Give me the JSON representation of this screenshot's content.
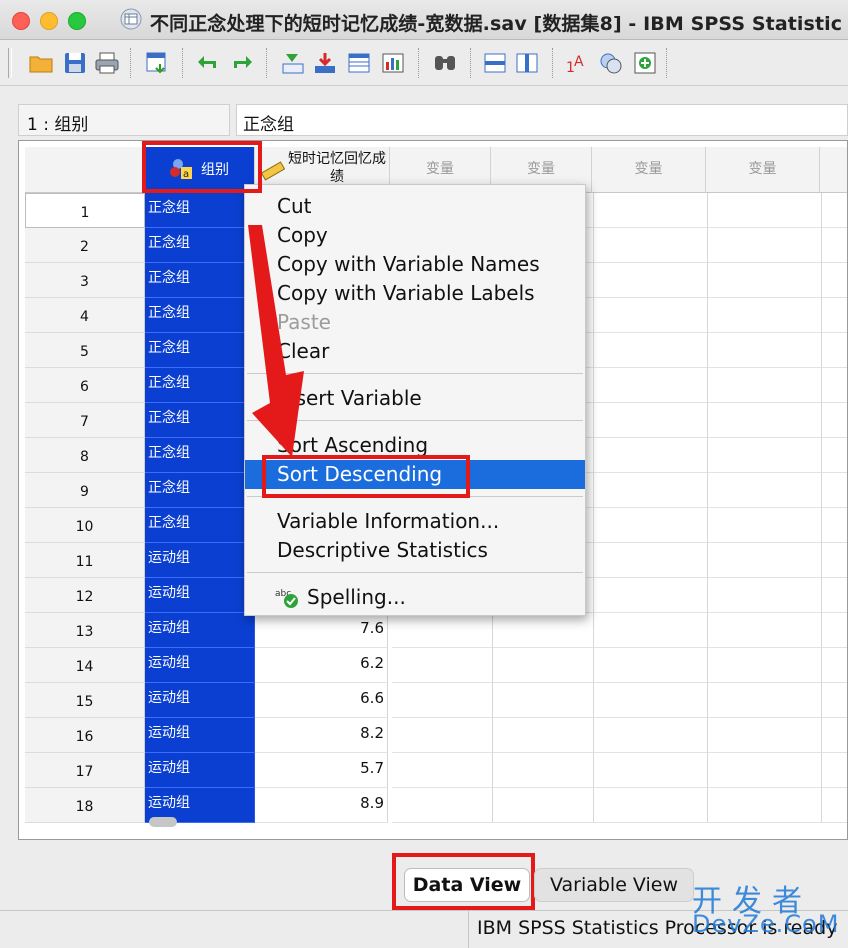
{
  "window": {
    "title": "不同正念处理下的短时记忆成绩-宽数据.sav [数据集8] - IBM SPSS Statistic"
  },
  "toolbar": {
    "icons": [
      "open-folder-icon",
      "save-icon",
      "print-icon",
      "recall-dialog-icon",
      "undo-icon",
      "redo-icon",
      "goto-case-icon",
      "goto-variable-icon",
      "variables-icon",
      "run-descriptives-icon",
      "find-icon",
      "insert-cases-icon",
      "insert-variable-icon",
      "split-file-icon",
      "select-cases-icon",
      "value-labels-icon",
      "use-sets-icon"
    ]
  },
  "cellbar": {
    "ref": "1 : 组别",
    "value": "正念组"
  },
  "grid": {
    "col_group_label": "组别",
    "col_score_label": "短时记忆回忆成绩",
    "empty_col_label": "变量",
    "rows": [
      {
        "n": "1",
        "group": "正念组",
        "score": ""
      },
      {
        "n": "2",
        "group": "正念组",
        "score": ""
      },
      {
        "n": "3",
        "group": "正念组",
        "score": ""
      },
      {
        "n": "4",
        "group": "正念组",
        "score": ""
      },
      {
        "n": "5",
        "group": "正念组",
        "score": ""
      },
      {
        "n": "6",
        "group": "正念组",
        "score": ""
      },
      {
        "n": "7",
        "group": "正念组",
        "score": ""
      },
      {
        "n": "8",
        "group": "正念组",
        "score": ""
      },
      {
        "n": "9",
        "group": "正念组",
        "score": ""
      },
      {
        "n": "10",
        "group": "正念组",
        "score": ""
      },
      {
        "n": "11",
        "group": "运动组",
        "score": ""
      },
      {
        "n": "12",
        "group": "运动组",
        "score": ""
      },
      {
        "n": "13",
        "group": "运动组",
        "score": "7.6"
      },
      {
        "n": "14",
        "group": "运动组",
        "score": "6.2"
      },
      {
        "n": "15",
        "group": "运动组",
        "score": "6.6"
      },
      {
        "n": "16",
        "group": "运动组",
        "score": "8.2"
      },
      {
        "n": "17",
        "group": "运动组",
        "score": "5.7"
      },
      {
        "n": "18",
        "group": "运动组",
        "score": "8.9"
      }
    ]
  },
  "context_menu": {
    "cut": "Cut",
    "copy": "Copy",
    "copy_names": "Copy with Variable Names",
    "copy_labels": "Copy with Variable Labels",
    "paste": "Paste",
    "clear": "Clear",
    "insert_variable": "Insert Variable",
    "sort_ascending": "Sort Ascending",
    "sort_descending": "Sort Descending",
    "variable_information": "Variable Information...",
    "descriptive_statistics": "Descriptive Statistics",
    "spelling": "Spelling..."
  },
  "tabs": {
    "data_view": "Data View",
    "variable_view": "Variable View"
  },
  "status": {
    "text": "IBM SPSS Statistics Processor is ready"
  },
  "watermark": {
    "cn": "开发者",
    "en": "DevZe.CoM"
  },
  "colors": {
    "selection_blue": "#0b3fd1",
    "menu_highlight": "#1b6dde",
    "annotation_red": "#e41a1a"
  }
}
